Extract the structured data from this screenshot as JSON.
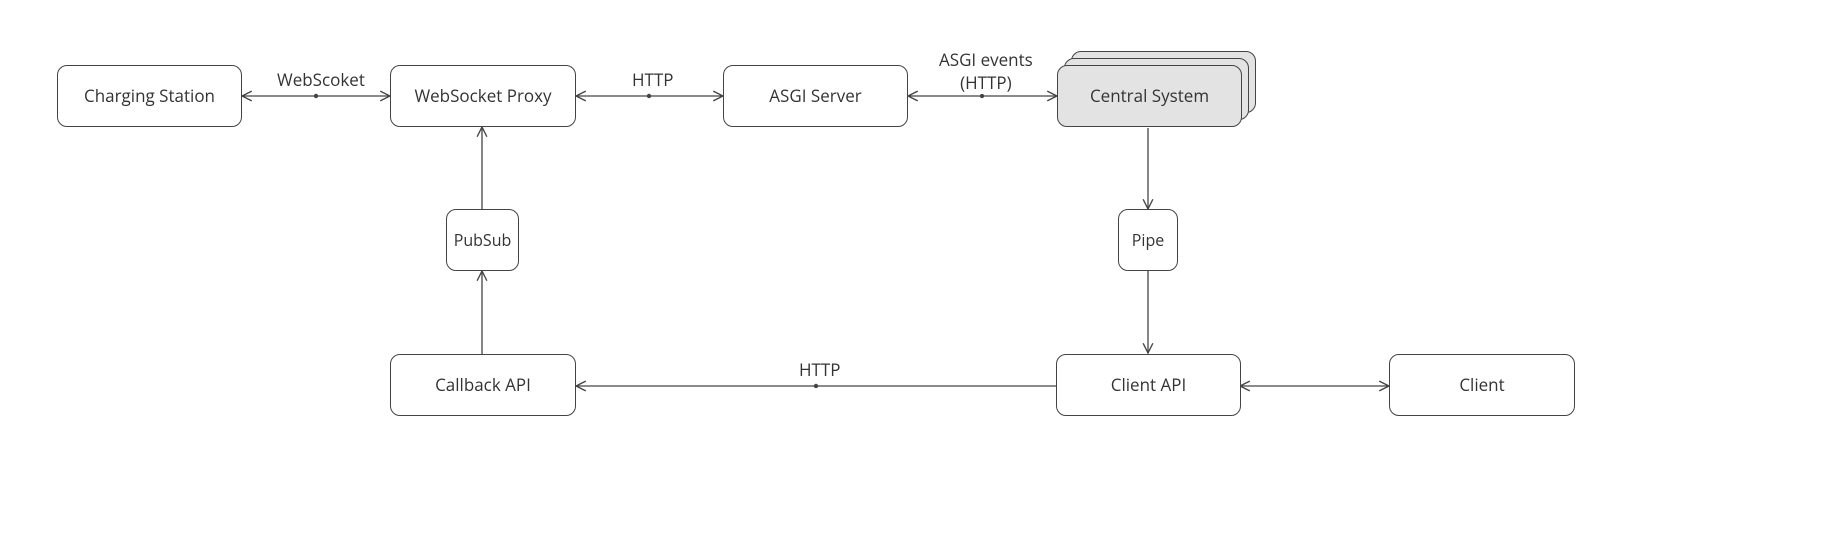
{
  "nodes": {
    "charging_station": "Charging Station",
    "websocket_proxy": "WebSocket Proxy",
    "asgi_server": "ASGI Server",
    "central_system": "Central System",
    "pubsub": "PubSub",
    "pipe": "Pipe",
    "callback_api": "Callback API",
    "client_api": "Client API",
    "client": "Client"
  },
  "edges": {
    "cs_wsproxy": "WebScoket",
    "wsproxy_asgi": "HTTP",
    "asgi_central": "ASGI events\n(HTTP)",
    "callback_client": "HTTP"
  }
}
